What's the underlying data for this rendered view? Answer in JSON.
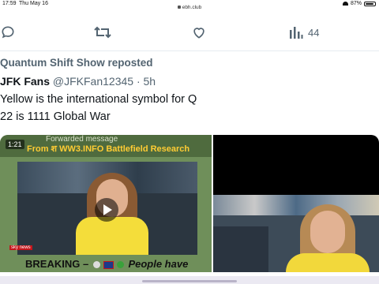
{
  "status_bar": {
    "time": "17:59",
    "date": "Thu May 16",
    "url": "ebh.club",
    "battery": "87%",
    "battery_level": 0.87
  },
  "actions": {
    "reply_icon": "reply-icon",
    "retweet_icon": "retweet-icon",
    "like_icon": "heart-icon",
    "views_icon": "views-chart-icon",
    "views_count": "44"
  },
  "tweet": {
    "repost_text": "Quantum Shift Show reposted",
    "author_name": "JFK Fans",
    "author_handle": "@JFKFan12345",
    "separator": "·",
    "time": "5h",
    "line1": "Yellow is the international symbol for Q",
    "line2": "22 is 1111 Global War"
  },
  "media_left": {
    "forwarded_label": "Forwarded message",
    "from_label": "From श WW3.INFO Battlefield Research",
    "duration": "1:21",
    "channel_badge": "sky news",
    "breaking_prefix": "BREAKING –",
    "breaking_suffix": "People have"
  },
  "colors": {
    "text_primary": "#0f1419",
    "text_secondary": "#536471",
    "divider": "#e6ecf0",
    "banner_yellow": "#ffcc33"
  }
}
